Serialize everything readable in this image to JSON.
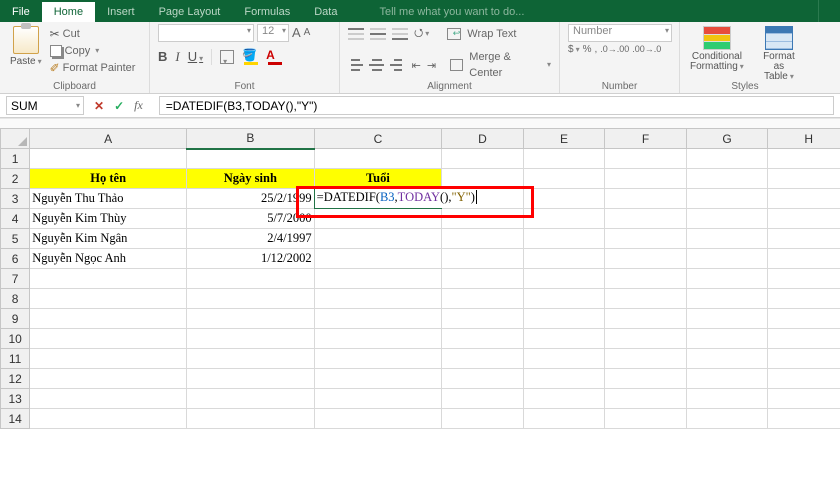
{
  "tabs": {
    "file": "File",
    "home": "Home",
    "insert": "Insert",
    "pagelayout": "Page Layout",
    "formulas": "Formulas",
    "data": "Data",
    "tellme": "Tell me what you want to do..."
  },
  "clipboard": {
    "paste": "Paste",
    "cut": "Cut",
    "copy": "Copy",
    "painter": "Format Painter",
    "label": "Clipboard"
  },
  "font": {
    "family": "",
    "size": "12",
    "growA": "A",
    "shrinkA": "A",
    "label": "Font"
  },
  "alignment": {
    "wrap": "Wrap Text",
    "merge": "Merge & Center",
    "label": "Alignment"
  },
  "number": {
    "format": "Number",
    "label": "Number",
    "percent": "%",
    "comma": ",",
    "inc": ".0→.00",
    "dec": ".00→.0",
    "cur": "$"
  },
  "styles": {
    "cf": "Conditional\nFormatting",
    "ft": "Format as\nTable",
    "label": "Styles"
  },
  "namebox": "SUM",
  "formula_bar": "=DATEDIF(B3,TODAY(),\"Y\")",
  "columns": [
    "A",
    "B",
    "C",
    "D",
    "E",
    "F",
    "G",
    "H"
  ],
  "row_headers": [
    "1",
    "2",
    "3",
    "4",
    "5",
    "6",
    "7",
    "8",
    "9",
    "10",
    "11",
    "12",
    "13",
    "14"
  ],
  "headers": {
    "A": "Họ tên",
    "B": "Ngày sinh",
    "C": "Tuổi"
  },
  "rows": [
    {
      "A": "Nguyễn Thu Thảo",
      "B": "25/2/1999"
    },
    {
      "A": "Nguyễn Kim Thùy",
      "B": "5/7/2000"
    },
    {
      "A": "Nguyễn Kim Ngân",
      "B": "2/4/1997"
    },
    {
      "A": "Nguyễn Ngọc Anh",
      "B": "1/12/2002"
    }
  ],
  "cell_formula": {
    "pre": "=DATEDIF(",
    "b3": "B3",
    "mid1": ",",
    "today": "TODAY",
    "paren": "()",
    "mid2": ",",
    "y": "\"Y\"",
    "post": ")"
  }
}
